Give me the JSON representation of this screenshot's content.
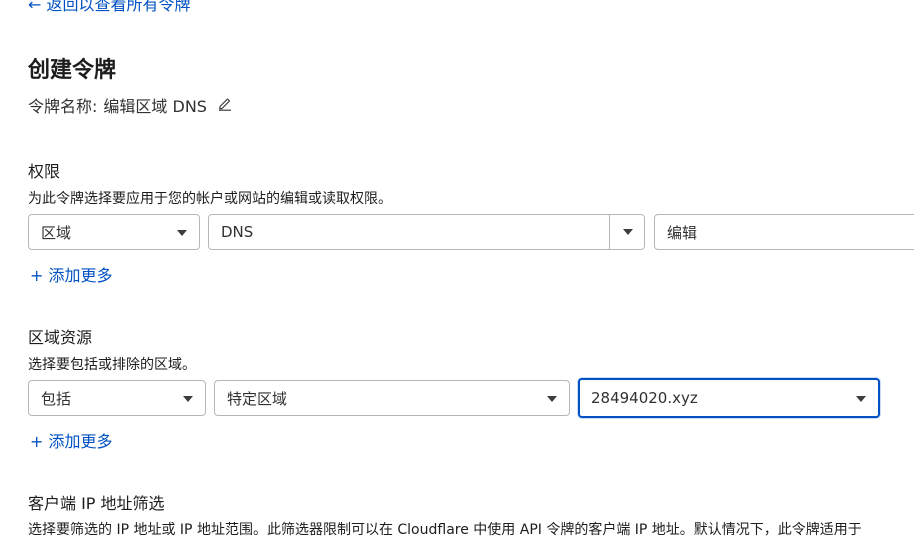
{
  "back_link": "← 返回以查看所有令牌",
  "page_title": "创建令牌",
  "token_name": {
    "label": "令牌名称:",
    "value": "编辑区域 DNS"
  },
  "permissions": {
    "title": "权限",
    "description": "为此令牌选择要应用于您的帐户或网站的编辑或读取权限。",
    "scope_select": "区域",
    "resource_select": "DNS",
    "access_select": "编辑",
    "add_more": "+ 添加更多"
  },
  "zone_resources": {
    "title": "区域资源",
    "description": "选择要包括或排除的区域。",
    "include_select": "包括",
    "type_select": "特定区域",
    "zone_select": "28494020.xyz",
    "add_more": "+ 添加更多"
  },
  "client_ip_filter": {
    "title": "客户端 IP 地址筛选",
    "description": "选择要筛选的 IP 地址或 IP 地址范围。此筛选器限制可以在 Cloudflare 中使用 API 令牌的客户端 IP 地址。默认情况下，此令牌适用于"
  },
  "colors": {
    "link": "#0051c3",
    "focus_border": "#0051c3",
    "text": "#1d1d1d"
  }
}
